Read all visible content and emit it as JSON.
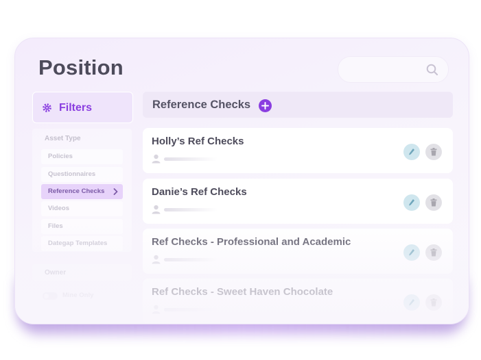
{
  "header": {
    "title": "Position"
  },
  "search": {
    "icon": "search-icon"
  },
  "filters": {
    "title": "Filters",
    "icon": "gear-icon",
    "asset_type": {
      "label": "Asset Type",
      "items": [
        {
          "label": "Policies",
          "active": false
        },
        {
          "label": "Questionnaires",
          "active": false
        },
        {
          "label": "Reference Checks",
          "active": true
        },
        {
          "label": "Videos",
          "active": false
        },
        {
          "label": "Files",
          "active": false
        },
        {
          "label": "Dategap Templates",
          "active": false
        }
      ]
    },
    "owner": {
      "label": "Owner"
    },
    "mine_only": {
      "label": "Mine Only",
      "enabled": false
    }
  },
  "list": {
    "title": "Reference Checks",
    "add_icon": "plus-icon",
    "items": [
      {
        "title": "Holly’s Ref Checks"
      },
      {
        "title": "Danie’s Ref Checks"
      },
      {
        "title": "Ref Checks - Professional and Academic"
      },
      {
        "title": "Ref Checks - Sweet Haven Chocolate"
      }
    ]
  },
  "colors": {
    "accent": "#8a3ee0",
    "title": "#4d4b5b",
    "edit": "#cfe6ee",
    "delete": "#e2e1e6"
  }
}
